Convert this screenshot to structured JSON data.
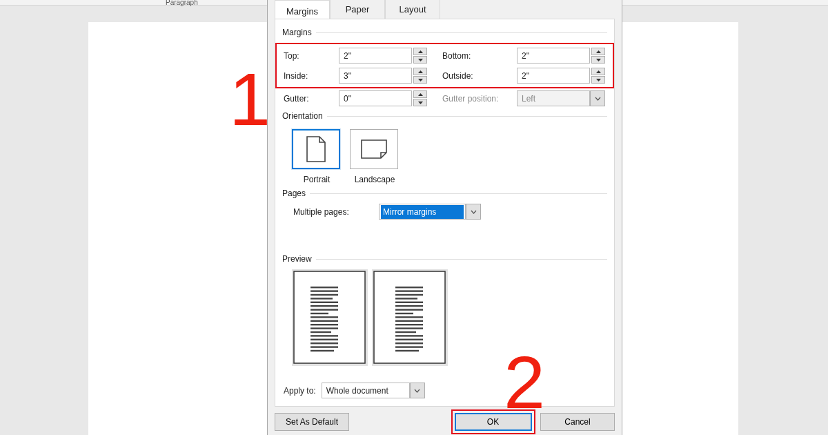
{
  "app": {
    "ribbon_group": "Paragraph"
  },
  "dialog": {
    "tabs": [
      {
        "label": "Margins",
        "selected": true
      },
      {
        "label": "Paper",
        "selected": false
      },
      {
        "label": "Layout",
        "selected": false
      }
    ],
    "margins": {
      "title": "Margins",
      "rows": [
        {
          "highlighted": true,
          "fields": [
            {
              "kind": "spin",
              "label": "Top:",
              "value": "2\""
            },
            {
              "kind": "spin",
              "label": "Bottom:",
              "value": "2\""
            }
          ]
        },
        {
          "highlighted": true,
          "fields": [
            {
              "kind": "spin",
              "label": "Inside:",
              "value": "3\""
            },
            {
              "kind": "spin",
              "label": "Outside:",
              "value": "2\""
            }
          ]
        },
        {
          "highlighted": false,
          "fields": [
            {
              "kind": "spin",
              "label": "Gutter:",
              "value": "0\""
            },
            {
              "kind": "dropdown",
              "label": "Gutter position:",
              "value": "Left",
              "disabled": true
            }
          ]
        }
      ]
    },
    "orientation": {
      "title": "Orientation",
      "options": [
        {
          "kind": "portrait",
          "label": "Portrait",
          "selected": true
        },
        {
          "kind": "landscape",
          "label": "Landscape",
          "selected": false
        }
      ]
    },
    "pages": {
      "title": "Pages",
      "multiple_pages": {
        "label": "Multiple pages:",
        "value": "Mirror margins"
      }
    },
    "preview": {
      "title": "Preview"
    },
    "apply_to": {
      "label": "Apply to:",
      "value": "Whole document"
    },
    "buttons": [
      {
        "label": "Set As Default",
        "highlighted": false
      },
      {
        "label": "OK",
        "highlighted": true
      },
      {
        "label": "Cancel",
        "highlighted": false
      }
    ]
  },
  "annotations": [
    {
      "text": "1"
    },
    {
      "text": "2"
    }
  ]
}
